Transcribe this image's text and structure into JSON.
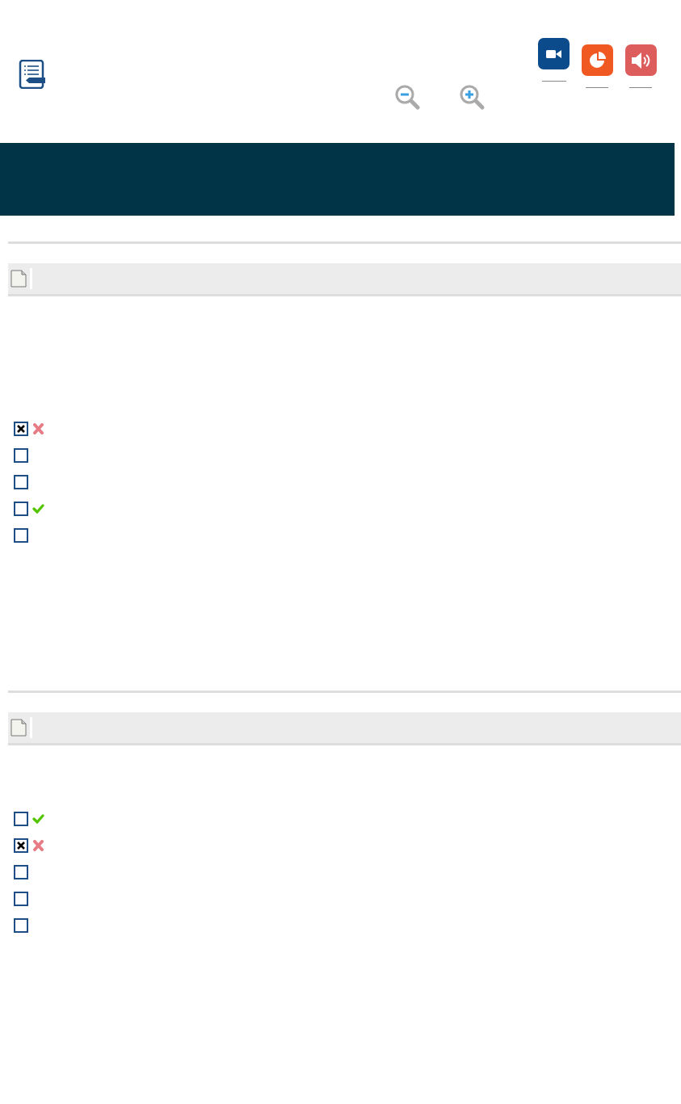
{
  "questions": [
    {
      "options": [
        {
          "checked": true,
          "correct": false
        },
        {
          "checked": false
        },
        {
          "checked": false
        },
        {
          "checked": false,
          "correct": true
        },
        {
          "checked": false
        }
      ]
    },
    {
      "options": [
        {
          "checked": false,
          "correct": true
        },
        {
          "checked": true,
          "correct": false
        },
        {
          "checked": false
        },
        {
          "checked": false
        },
        {
          "checked": false
        }
      ]
    }
  ]
}
